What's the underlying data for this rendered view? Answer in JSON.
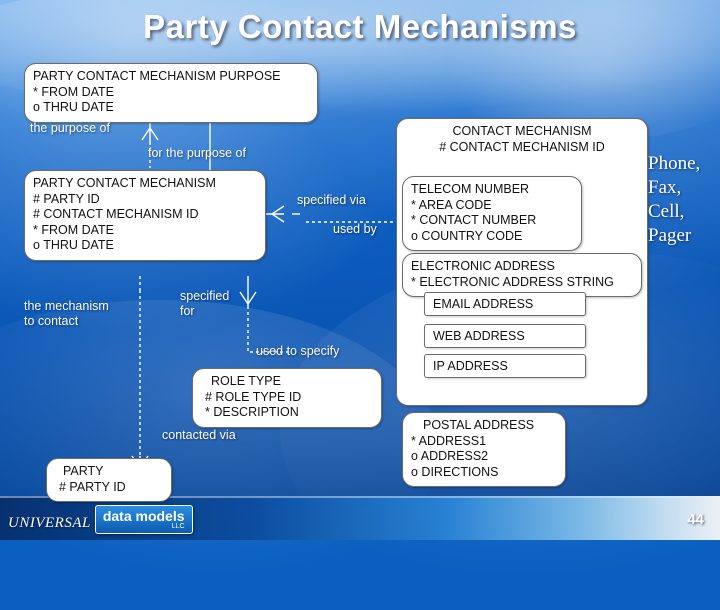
{
  "slide": {
    "title": "Party Contact Mechanisms",
    "page_number": "44",
    "brand": {
      "universal": "UNIVERSAL",
      "logo_text": "data models",
      "logo_suffix": "LLC"
    },
    "colors": {
      "background_blue": "#0a5fc0",
      "entity_fill": "#ffffff",
      "entity_border": "#6b6b6b",
      "text_white": "#ffffff",
      "text_dark": "#111111"
    }
  },
  "entities": [
    {
      "name": "party-contact-mechanism-purpose",
      "title": "PARTY CONTACT MECHANISM PURPOSE",
      "attributes": [
        "*  FROM DATE",
        "o  THRU DATE"
      ]
    },
    {
      "name": "party-contact-mechanism",
      "title": "PARTY CONTACT MECHANISM",
      "attributes": [
        "# PARTY ID",
        "# CONTACT MECHANISM ID",
        "*  FROM DATE",
        "o  THRU DATE"
      ]
    },
    {
      "name": "contact-mechanism",
      "title": "CONTACT MECHANISM",
      "attributes": [
        "# CONTACT MECHANISM  ID"
      ]
    },
    {
      "name": "telecom-number",
      "title": "TELECOM NUMBER",
      "attributes": [
        "*  AREA CODE",
        "*  CONTACT NUMBER",
        "o  COUNTRY CODE"
      ]
    },
    {
      "name": "electronic-address",
      "title": "ELECTRONIC ADDRESS",
      "attributes": [
        "*  ELECTRONIC ADDRESS STRING"
      ]
    },
    {
      "name": "postal-address",
      "title": "POSTAL ADDRESS",
      "attributes": [
        "*  ADDRESS1",
        "o  ADDRESS2",
        "o  DIRECTIONS"
      ]
    },
    {
      "name": "role-type",
      "title": "ROLE TYPE",
      "attributes": [
        "#  ROLE TYPE ID",
        "*  DESCRIPTION"
      ]
    },
    {
      "name": "party",
      "title": "PARTY",
      "attributes": [
        "#  PARTY ID"
      ]
    }
  ],
  "subtypes": [
    {
      "name": "email-address",
      "label": "EMAIL ADDRESS"
    },
    {
      "name": "web-address",
      "label": "WEB ADDRESS"
    },
    {
      "name": "ip-address",
      "label": "IP ADDRESS"
    }
  ],
  "relationship_labels": [
    {
      "name": "label-the-purpose-of",
      "text": "the purpose of"
    },
    {
      "name": "label-for-the-purpose-of",
      "text": "for the purpose of"
    },
    {
      "name": "label-specified-via",
      "text": "specified via"
    },
    {
      "name": "label-used-by",
      "text": "used by"
    },
    {
      "name": "label-the-mechanism-to-contact",
      "text": "the mechanism\nto contact"
    },
    {
      "name": "label-specified-for",
      "text": "specified\nfor"
    },
    {
      "name": "label-used-to-specify",
      "text": "used to specify"
    },
    {
      "name": "label-contacted-via",
      "text": "contacted via"
    }
  ],
  "side_note": {
    "name": "telecom-examples",
    "lines": [
      "Phone,",
      "Fax,",
      "Cell,",
      "Pager"
    ]
  }
}
